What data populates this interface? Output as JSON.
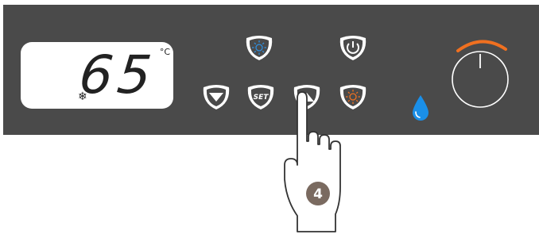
{
  "display": {
    "value": "65",
    "unit": "°C",
    "snow_glyph": "❄"
  },
  "buttons": {
    "down": {
      "icon": "chevron-down-icon"
    },
    "set": {
      "label": "SET"
    },
    "up": {
      "icon": "chevron-up-icon"
    },
    "light_blue": {
      "icon": "sun-icon",
      "color": "#2f8fdf"
    },
    "light_orange": {
      "icon": "sun-icon",
      "color": "#f07020"
    },
    "power": {
      "icon": "power-icon"
    }
  },
  "indicator": {
    "icon": "water-drop-icon",
    "color": "#1a8fe8"
  },
  "knob": {
    "icon": "dial-knob-icon",
    "arc_color": "#f07020"
  },
  "callout": {
    "number": "4"
  },
  "colors": {
    "panel": "#4a4a4a",
    "button": "#ffffff",
    "hand_badge": "#7a6a60"
  }
}
